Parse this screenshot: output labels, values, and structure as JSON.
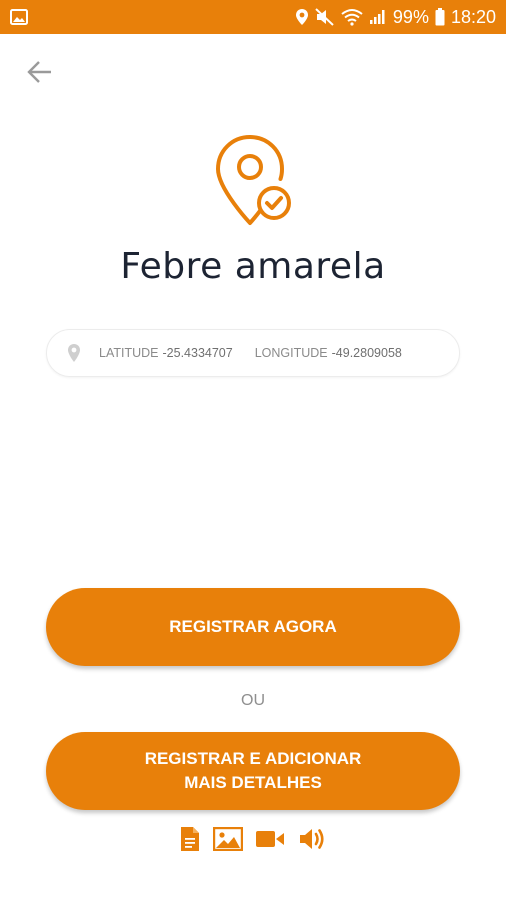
{
  "statusbar": {
    "battery": "99%",
    "time": "18:20"
  },
  "title": "Febre amarela",
  "coords": {
    "lat_label": "LATITUDE",
    "lat_value": "-25.4334707",
    "lon_label": "LONGITUDE",
    "lon_value": "-49.2809058"
  },
  "actions": {
    "register_now": "REGISTRAR AGORA",
    "or": "OU",
    "register_details_line1": "REGISTRAR E ADICIONAR",
    "register_details_line2": "MAIS DETALHES"
  },
  "colors": {
    "accent": "#E8800A",
    "title": "#1d2433"
  },
  "icons": [
    "image-icon",
    "location-icon",
    "mute-icon",
    "wifi-icon",
    "signal-icon",
    "battery-icon",
    "back-arrow-icon",
    "location-check-icon",
    "pin-icon",
    "document-icon",
    "photo-icon",
    "video-icon",
    "audio-icon"
  ]
}
